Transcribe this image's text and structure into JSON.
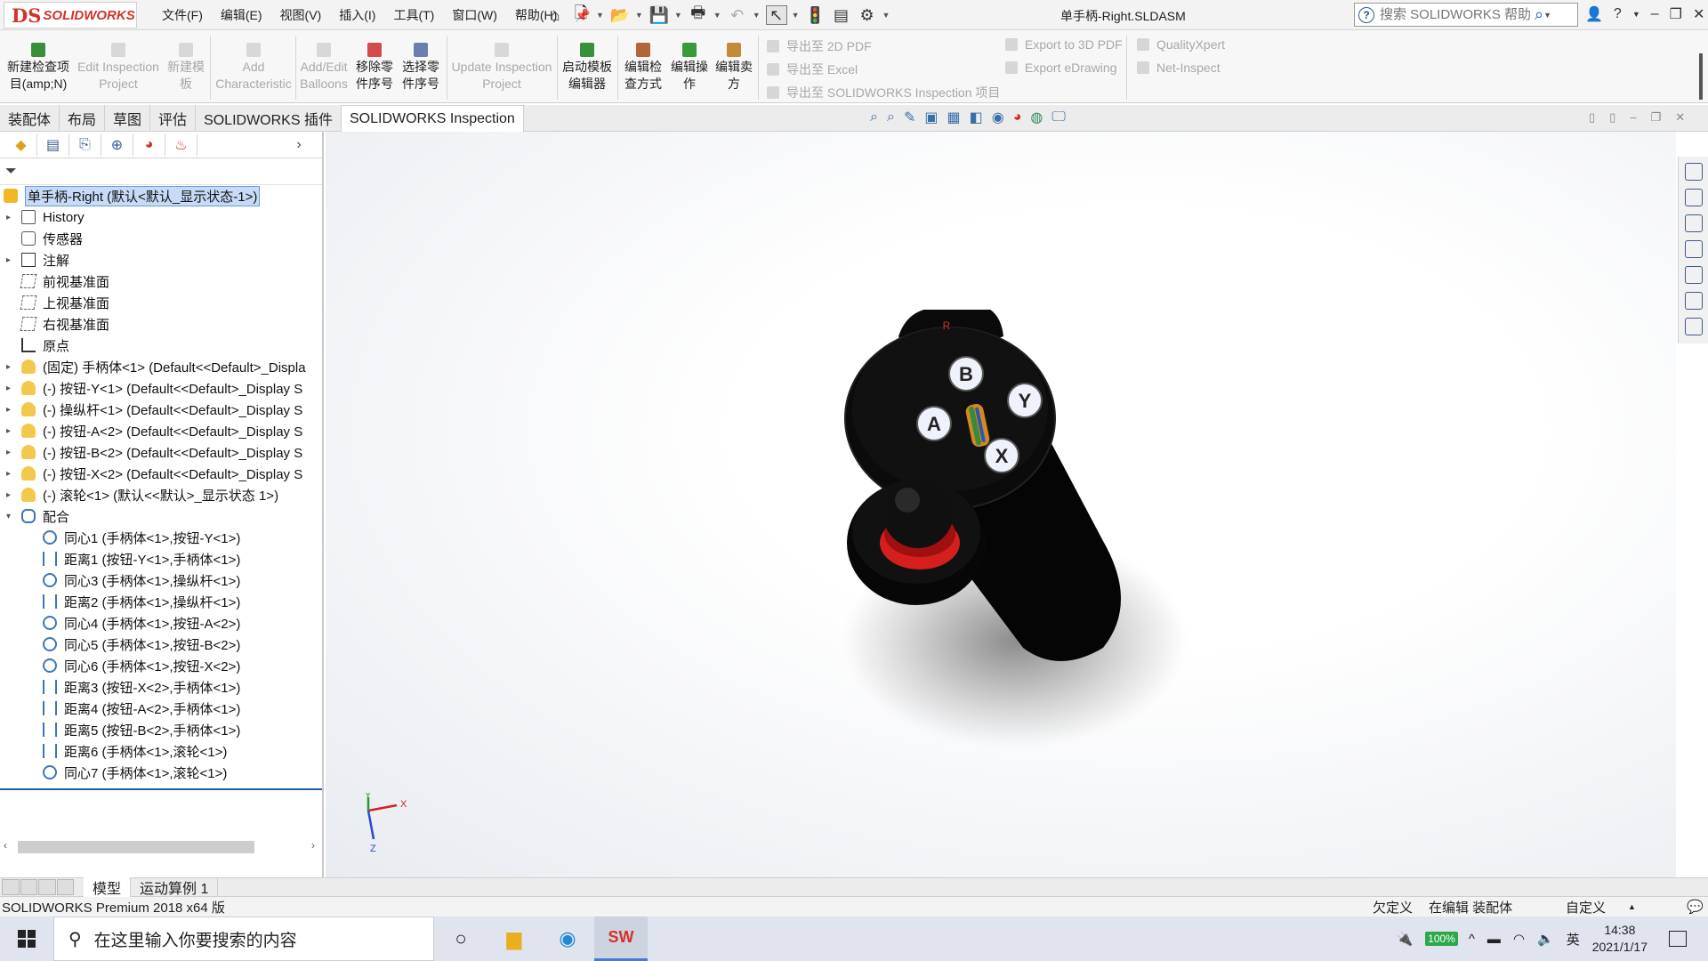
{
  "app": {
    "logo_ds": "DS",
    "logo_text": "SOLIDWORKS",
    "menus": [
      "文件(F)",
      "编辑(E)",
      "视图(V)",
      "插入(I)",
      "工具(T)",
      "窗口(W)",
      "帮助(H)"
    ],
    "document_title": "单手柄-Right.SLDASM",
    "search_placeholder": "搜索 SOLIDWORKS 帮助"
  },
  "ribbon": {
    "new_inspection": "新建检查项目(amp;N)",
    "edit_inspection": "Edit Inspection Project",
    "new_template": "新建模板",
    "add_characteristic": "Add Characteristic",
    "add_edit_balloons": "Add/Edit Balloons",
    "remove_part_number": "移除零件序号",
    "select_part_number": "选择零件序号",
    "update_inspection": "Update Inspection Project",
    "launch_template_editor": "启动模板编辑器",
    "edit_inspection_method": "编辑检查方式",
    "edit_operation": "编辑操作",
    "edit_vendor": "编辑卖方",
    "export_2d_pdf": "导出至 2D PDF",
    "export_excel": "导出至 Excel",
    "export_sw_inspection": "导出至 SOLIDWORKS Inspection 项目",
    "export_3d_pdf": "Export to 3D PDF",
    "export_edrawing": "Export eDrawing",
    "qualityxpert": "QualityXpert",
    "net_inspect": "Net-Inspect"
  },
  "command_tabs": [
    "装配体",
    "布局",
    "草图",
    "评估",
    "SOLIDWORKS 插件",
    "SOLIDWORKS Inspection"
  ],
  "tree": {
    "root": "单手柄-Right (默认<默认_显示状态-1>)",
    "items": [
      {
        "label": "History",
        "icon": "history-icon",
        "expand": "▸"
      },
      {
        "label": "传感器",
        "icon": "sensor-icon",
        "expand": ""
      },
      {
        "label": "注解",
        "icon": "annotation-icon",
        "expand": "▸"
      },
      {
        "label": "前视基准面",
        "icon": "plane-icon",
        "expand": ""
      },
      {
        "label": "上视基准面",
        "icon": "plane-icon",
        "expand": ""
      },
      {
        "label": "右视基准面",
        "icon": "plane-icon",
        "expand": ""
      },
      {
        "label": "原点",
        "icon": "origin-icon",
        "expand": ""
      },
      {
        "label": "(固定) 手柄体<1> (Default<<Default>_Displa",
        "icon": "part-icon",
        "expand": "▸"
      },
      {
        "label": "(-) 按钮-Y<1> (Default<<Default>_Display S",
        "icon": "part-icon",
        "expand": "▸"
      },
      {
        "label": "(-) 操纵杆<1> (Default<<Default>_Display S",
        "icon": "part-icon",
        "expand": "▸"
      },
      {
        "label": "(-) 按钮-A<2> (Default<<Default>_Display S",
        "icon": "part-icon",
        "expand": "▸"
      },
      {
        "label": "(-) 按钮-B<2> (Default<<Default>_Display S",
        "icon": "part-icon",
        "expand": "▸"
      },
      {
        "label": "(-) 按钮-X<2> (Default<<Default>_Display S",
        "icon": "part-icon",
        "expand": "▸"
      },
      {
        "label": "(-) 滚轮<1> (默认<<默认>_显示状态 1>)",
        "icon": "part-icon",
        "expand": "▸"
      },
      {
        "label": "配合",
        "icon": "mates-icon",
        "expand": "▾"
      }
    ],
    "mates": [
      {
        "label": "同心1 (手柄体<1>,按钮-Y<1>)",
        "type": "concentric"
      },
      {
        "label": "距离1 (按钮-Y<1>,手柄体<1>)",
        "type": "distance"
      },
      {
        "label": "同心3 (手柄体<1>,操纵杆<1>)",
        "type": "concentric"
      },
      {
        "label": "距离2 (手柄体<1>,操纵杆<1>)",
        "type": "distance"
      },
      {
        "label": "同心4 (手柄体<1>,按钮-A<2>)",
        "type": "concentric"
      },
      {
        "label": "同心5 (手柄体<1>,按钮-B<2>)",
        "type": "concentric"
      },
      {
        "label": "同心6 (手柄体<1>,按钮-X<2>)",
        "type": "concentric"
      },
      {
        "label": "距离3 (按钮-X<2>,手柄体<1>)",
        "type": "distance"
      },
      {
        "label": "距离4 (按钮-A<2>,手柄体<1>)",
        "type": "distance"
      },
      {
        "label": "距离5 (按钮-B<2>,手柄体<1>)",
        "type": "distance"
      },
      {
        "label": "距离6 (手柄体<1>,滚轮<1>)",
        "type": "distance"
      },
      {
        "label": "同心7 (手柄体<1>,滚轮<1>)",
        "type": "concentric"
      }
    ]
  },
  "model": {
    "button_b": "B",
    "button_y": "Y",
    "button_a": "A",
    "button_x": "X",
    "top_label": "R"
  },
  "triad": {
    "x": "X",
    "y": "Y",
    "z": "Z"
  },
  "bottom_tabs": [
    "模型",
    "运动算例 1"
  ],
  "status": {
    "product": "SOLIDWORKS Premium 2018 x64 版",
    "defined": "欠定义",
    "editing": "在编辑 装配体",
    "custom": "自定义"
  },
  "taskbar": {
    "search_placeholder": "在这里输入你要搜索的内容",
    "battery": "100%",
    "ime": "英",
    "time": "14:38",
    "date": "2021/1/17"
  },
  "colors": {
    "brand": "#d4312a",
    "selection": "#c7dbf6",
    "accent": "#1f5fb0"
  }
}
